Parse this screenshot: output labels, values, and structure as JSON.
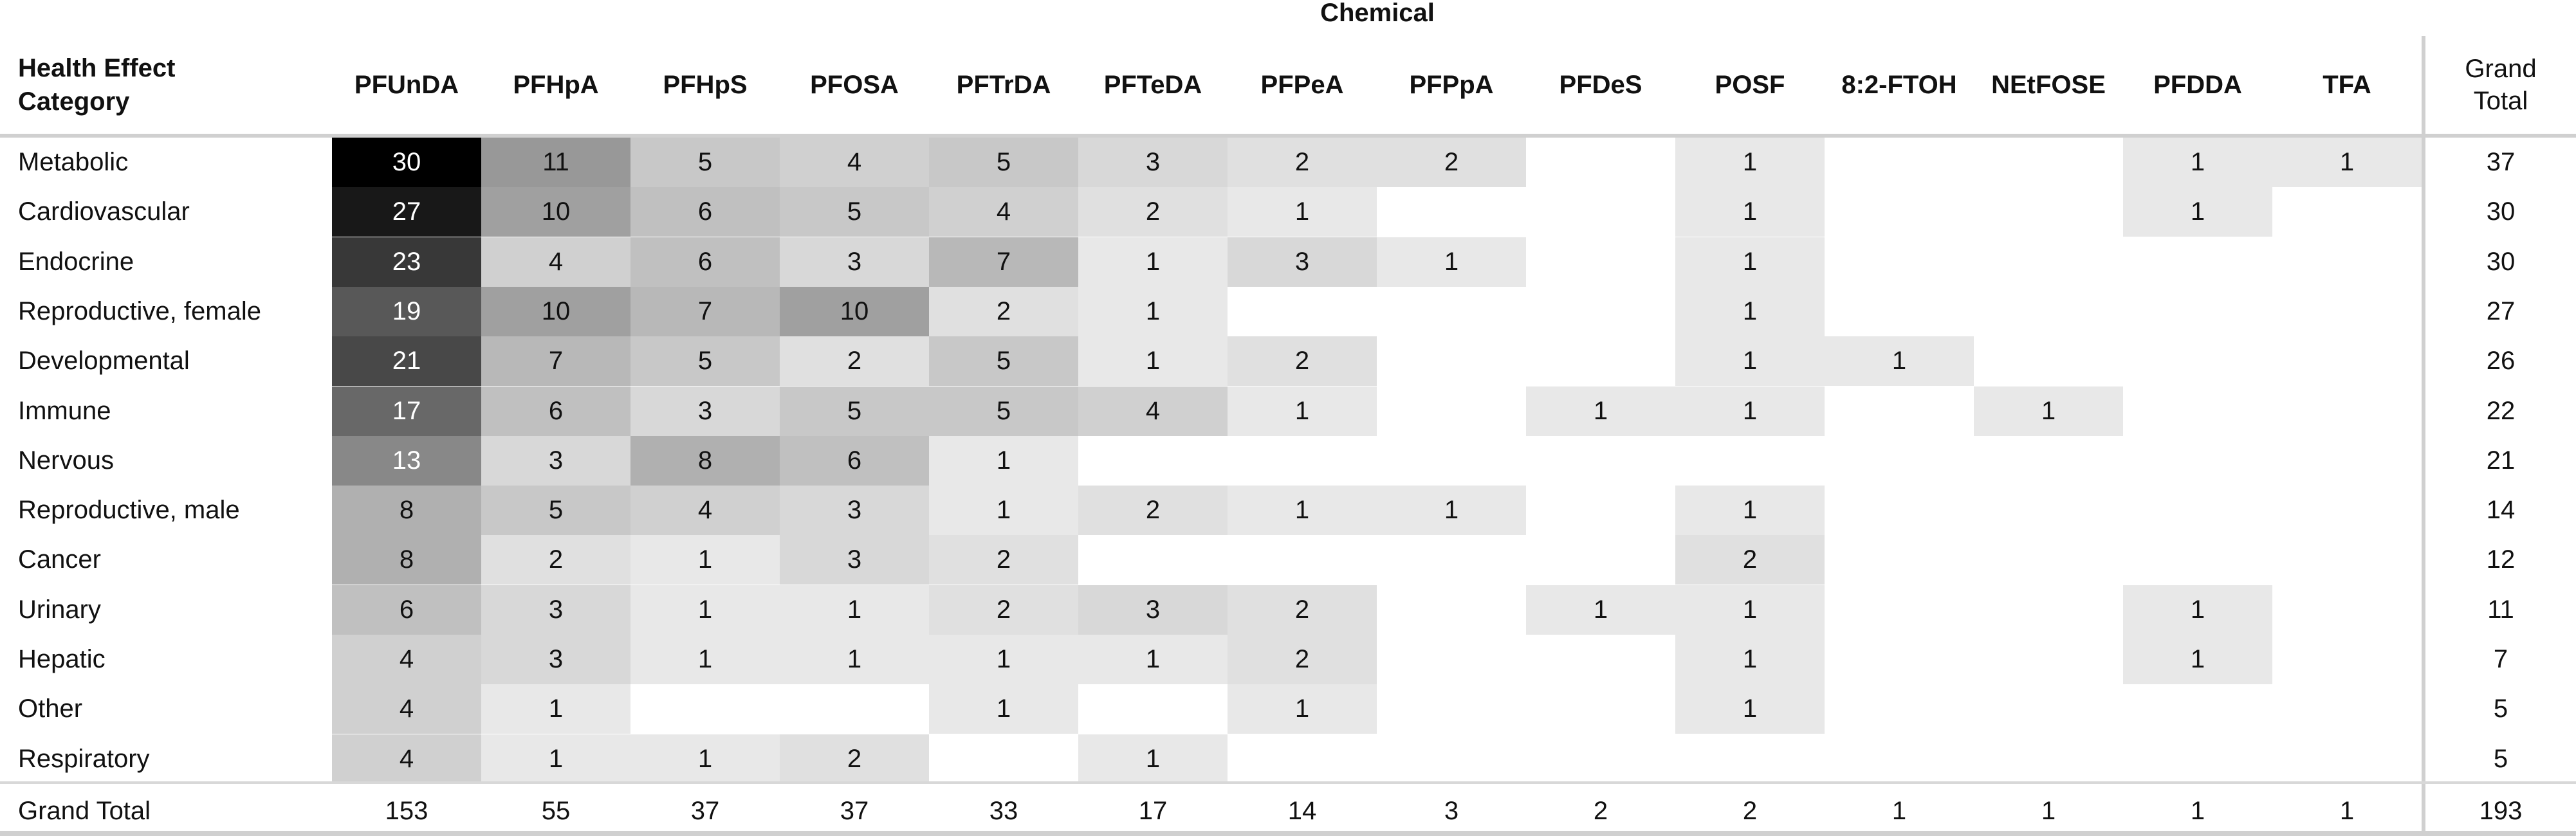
{
  "chart_data": {
    "type": "heatmap",
    "title": "Chemical",
    "row_header": "Health Effect Category",
    "columns": [
      "PFUnDA",
      "PFHpA",
      "PFHpS",
      "PFOSA",
      "PFTrDA",
      "PFTeDA",
      "PFPeA",
      "PFPpA",
      "PFDeS",
      "POSF",
      "8:2-FTOH",
      "NEtFOSE",
      "PFDDA",
      "TFA"
    ],
    "total_label": "Grand Total",
    "rows": [
      {
        "label": "Metabolic",
        "values": [
          30,
          11,
          5,
          4,
          5,
          3,
          2,
          2,
          null,
          1,
          null,
          null,
          1,
          1
        ],
        "total": 37
      },
      {
        "label": "Cardiovascular",
        "values": [
          27,
          10,
          6,
          5,
          4,
          2,
          1,
          null,
          null,
          1,
          null,
          null,
          1,
          null
        ],
        "total": 30
      },
      {
        "label": "Endocrine",
        "values": [
          23,
          4,
          6,
          3,
          7,
          1,
          3,
          1,
          null,
          1,
          null,
          null,
          null,
          null
        ],
        "total": 30
      },
      {
        "label": "Reproductive, female",
        "values": [
          19,
          10,
          7,
          10,
          2,
          1,
          null,
          null,
          null,
          1,
          null,
          null,
          null,
          null
        ],
        "total": 27
      },
      {
        "label": "Developmental",
        "values": [
          21,
          7,
          5,
          2,
          5,
          1,
          2,
          null,
          null,
          1,
          1,
          null,
          null,
          null
        ],
        "total": 26
      },
      {
        "label": "Immune",
        "values": [
          17,
          6,
          3,
          5,
          5,
          4,
          1,
          null,
          1,
          1,
          null,
          1,
          null,
          null
        ],
        "total": 22
      },
      {
        "label": "Nervous",
        "values": [
          13,
          3,
          8,
          6,
          1,
          null,
          null,
          null,
          null,
          null,
          null,
          null,
          null,
          null
        ],
        "total": 21
      },
      {
        "label": "Reproductive, male",
        "values": [
          8,
          5,
          4,
          3,
          1,
          2,
          1,
          1,
          null,
          1,
          null,
          null,
          null,
          null
        ],
        "total": 14
      },
      {
        "label": "Cancer",
        "values": [
          8,
          2,
          1,
          3,
          2,
          null,
          null,
          null,
          null,
          2,
          null,
          null,
          null,
          null
        ],
        "total": 12
      },
      {
        "label": "Urinary",
        "values": [
          6,
          3,
          1,
          1,
          2,
          3,
          2,
          null,
          1,
          1,
          null,
          null,
          1,
          null
        ],
        "total": 11
      },
      {
        "label": "Hepatic",
        "values": [
          4,
          3,
          1,
          1,
          1,
          1,
          2,
          null,
          null,
          1,
          null,
          null,
          1,
          null
        ],
        "total": 7
      },
      {
        "label": "Other",
        "values": [
          4,
          1,
          null,
          null,
          1,
          null,
          1,
          null,
          null,
          1,
          null,
          null,
          null,
          null
        ],
        "total": 5
      },
      {
        "label": "Respiratory",
        "values": [
          4,
          1,
          1,
          2,
          null,
          1,
          null,
          null,
          null,
          null,
          null,
          null,
          null,
          null
        ],
        "total": 5
      }
    ],
    "grand_total_row": {
      "label": "Grand Total",
      "values": [
        153,
        55,
        37,
        37,
        33,
        17,
        14,
        3,
        2,
        2,
        1,
        1,
        1,
        1
      ],
      "total": 193
    },
    "color_scale": {
      "min_value": 1,
      "min_color": "#e8e8e8",
      "max_value": 30,
      "max_color": "#000000"
    }
  }
}
